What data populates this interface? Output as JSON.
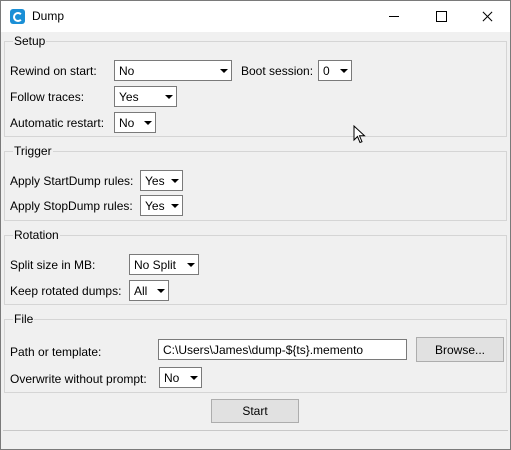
{
  "window": {
    "title": "Dump",
    "icon": "app-icon"
  },
  "setup": {
    "legend": "Setup",
    "rewind_label": "Rewind on start:",
    "rewind_value": "No",
    "boot_label": "Boot session:",
    "boot_value": "0",
    "follow_label": "Follow traces:",
    "follow_value": "Yes",
    "restart_label": "Automatic restart:",
    "restart_value": "No"
  },
  "trigger": {
    "legend": "Trigger",
    "start_label": "Apply StartDump rules:",
    "start_value": "Yes",
    "stop_label": "Apply StopDump rules:",
    "stop_value": "Yes"
  },
  "rotation": {
    "legend": "Rotation",
    "split_label": "Split size in MB:",
    "split_value": "No Split",
    "keep_label": "Keep rotated dumps:",
    "keep_value": "All"
  },
  "file": {
    "legend": "File",
    "path_label": "Path or template:",
    "path_value": "C:\\Users\\James\\dump-${ts}.memento",
    "browse_label": "Browse...",
    "overwrite_label": "Overwrite without prompt:",
    "overwrite_value": "No"
  },
  "actions": {
    "start_label": "Start"
  }
}
